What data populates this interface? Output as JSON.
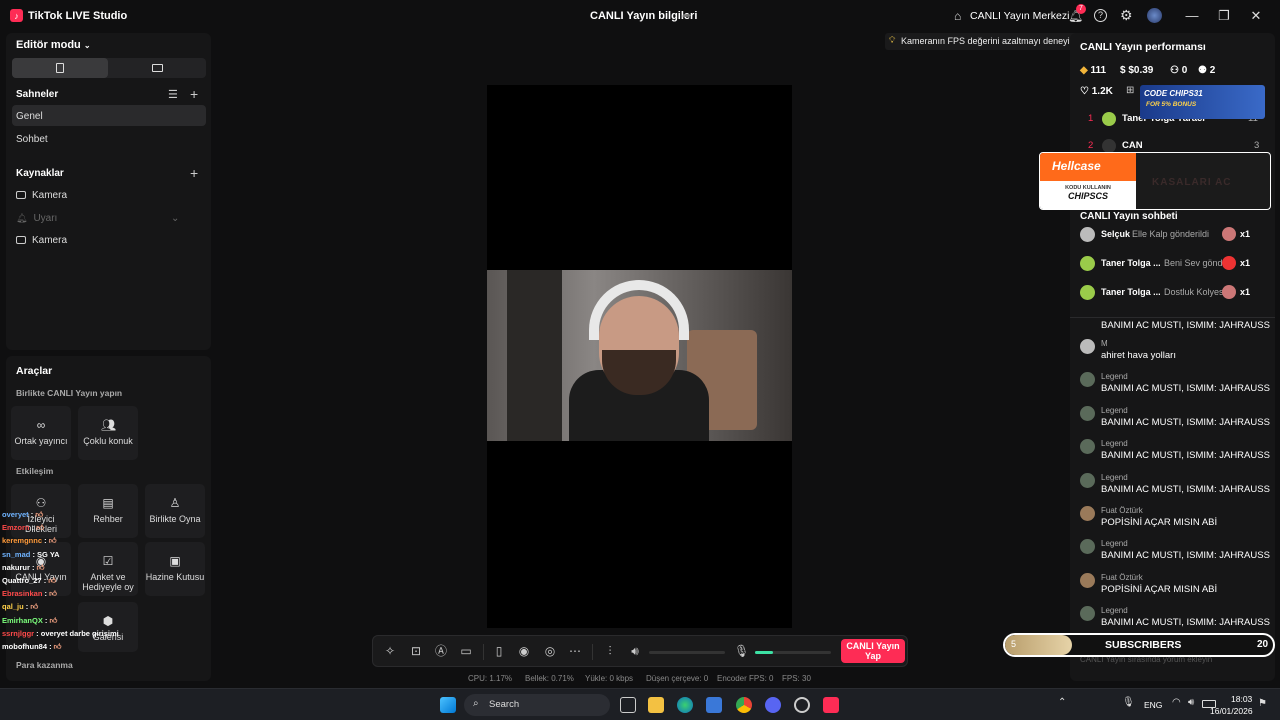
{
  "app": {
    "title": "TikTok LIVE Studio",
    "center_title": "CANLI Yayın bilgileri"
  },
  "titlebar": {
    "live_center": "CANLI Yayın Merkezi",
    "notif_count": "7"
  },
  "left": {
    "editor_mode": "Editör modu",
    "scenes_title": "Sahneler",
    "scenes": [
      "Genel",
      "Sohbet"
    ],
    "sources_title": "Kaynaklar",
    "sources": [
      "Kamera",
      "Uyarı",
      "Kamera"
    ]
  },
  "tools": {
    "title": "Araçlar",
    "collab_title": "Birlikte CANLI Yayın yapın",
    "collab": [
      "Ortak yayıncı",
      "Çoklu konuk"
    ],
    "interaction_title": "Etkileşim",
    "interaction": [
      "İzleyici Dilekleri",
      "Rehber",
      "Birlikte Oyna",
      "CANLI Yayın",
      "Anket ve Hediyeyle oy",
      "Hazine Kutusu",
      "Galerisi"
    ],
    "monetize_title": "Para kazanma"
  },
  "hint": "Kameranın FPS değerini azaltmayı deneyin",
  "right": {
    "perf_title": "CANLI Yayın performansı",
    "stats": {
      "gems": "111",
      "money": "$0.39",
      "viewers": "0",
      "followers": "2",
      "likes": "1.2K"
    },
    "ranking": [
      {
        "rank": "1",
        "name": "Taner Tolga Yaracı",
        "score": "11"
      },
      {
        "rank": "2",
        "name": "CAN",
        "score": "3"
      }
    ],
    "chat_title": "CANLI Yayın sohbeti",
    "gifts": [
      {
        "name": "Selçuk",
        "text": "Elle Kalp gönderildi",
        "count": "x1"
      },
      {
        "name": "Taner Tolga ...",
        "text": "Beni Sev göndı",
        "count": "x1"
      },
      {
        "name": "Taner Tolga ...",
        "text": "Dostluk Kolyes",
        "count": "x1"
      }
    ],
    "messages": [
      {
        "user": "",
        "text": "BANIMI AC MUSTI, ISMIM: JAHRAUSS"
      },
      {
        "user": "M",
        "text": "ahiret hava yolları"
      },
      {
        "user": "Legend",
        "text": "BANIMI AC MUSTI, ISMIM: JAHRAUSS"
      },
      {
        "user": "Legend",
        "text": "BANIMI AC MUSTI, ISMIM: JAHRAUSS"
      },
      {
        "user": "Legend",
        "text": "BANIMI AC MUSTI, ISMIM: JAHRAUSS"
      },
      {
        "user": "Legend",
        "text": "BANIMI AC MUSTI, ISMIM: JAHRAUSS"
      },
      {
        "user": "Fuat Öztürk",
        "text": "POPİSİNİ AÇAR MISIN ABİ"
      },
      {
        "user": "Legend",
        "text": "BANIMI AC MUSTI, ISMIM: JAHRAUSS"
      },
      {
        "user": "Fuat Öztürk",
        "text": "POPİSİNİ AÇAR MISIN ABİ"
      },
      {
        "user": "Legend",
        "text": "BANIMI AC MUSTI, ISMIM: JAHRAUSS"
      }
    ],
    "chat_placeholder": "CANLI Yayın sırasında yorum ekleyin"
  },
  "overlay_chat": [
    {
      "name": "overyet",
      "color": "#6fb3ff"
    },
    {
      "name": "Emzorn",
      "color": "#ff4a4a"
    },
    {
      "name": "keremgnnc",
      "color": "#ff9a3a"
    },
    {
      "name": "sn_mad",
      "text": "SG YA",
      "color": "#6fb3ff"
    },
    {
      "name": "nakurur",
      "color": "#ffffff"
    },
    {
      "name": "Quattro_27",
      "color": "#ffffff"
    },
    {
      "name": "Ebrasinkan",
      "color": "#ff4a4a"
    },
    {
      "name": "qal_ju",
      "color": "#ffd04a"
    },
    {
      "name": "EmirhanQX",
      "color": "#7cff7c"
    },
    {
      "name": "ssrnjlggr",
      "text": "overyet darbe girişimi",
      "color": "#ff4a4a"
    },
    {
      "name": "mobofhun84",
      "color": "#ffffff"
    }
  ],
  "ads": {
    "code": "CODE CHIPS31",
    "bonus": "FOR 5% BONUS",
    "hellcase": "Hellcase",
    "kodu": "KODU KULLANIN",
    "chipscs": "CHIPSCS",
    "kasalari": "KASALARI AC"
  },
  "subs": {
    "left": "5",
    "label": "SUBSCRIBERS",
    "right": "20",
    "progress": 0.25
  },
  "status": {
    "cpu": "CPU:  1.17%",
    "ram": "Bellek:  0.71%",
    "upload": "Yükle:  0 kbps",
    "dropped": "Düşen çerçeve:  0",
    "encoder": "Encoder FPS:  0",
    "fps": "FPS:  30"
  },
  "live_button": "CANLI Yayın Yap",
  "taskbar": {
    "search": "Search",
    "lang": "ENG",
    "time": "18:03",
    "date": "16/01/2026"
  }
}
